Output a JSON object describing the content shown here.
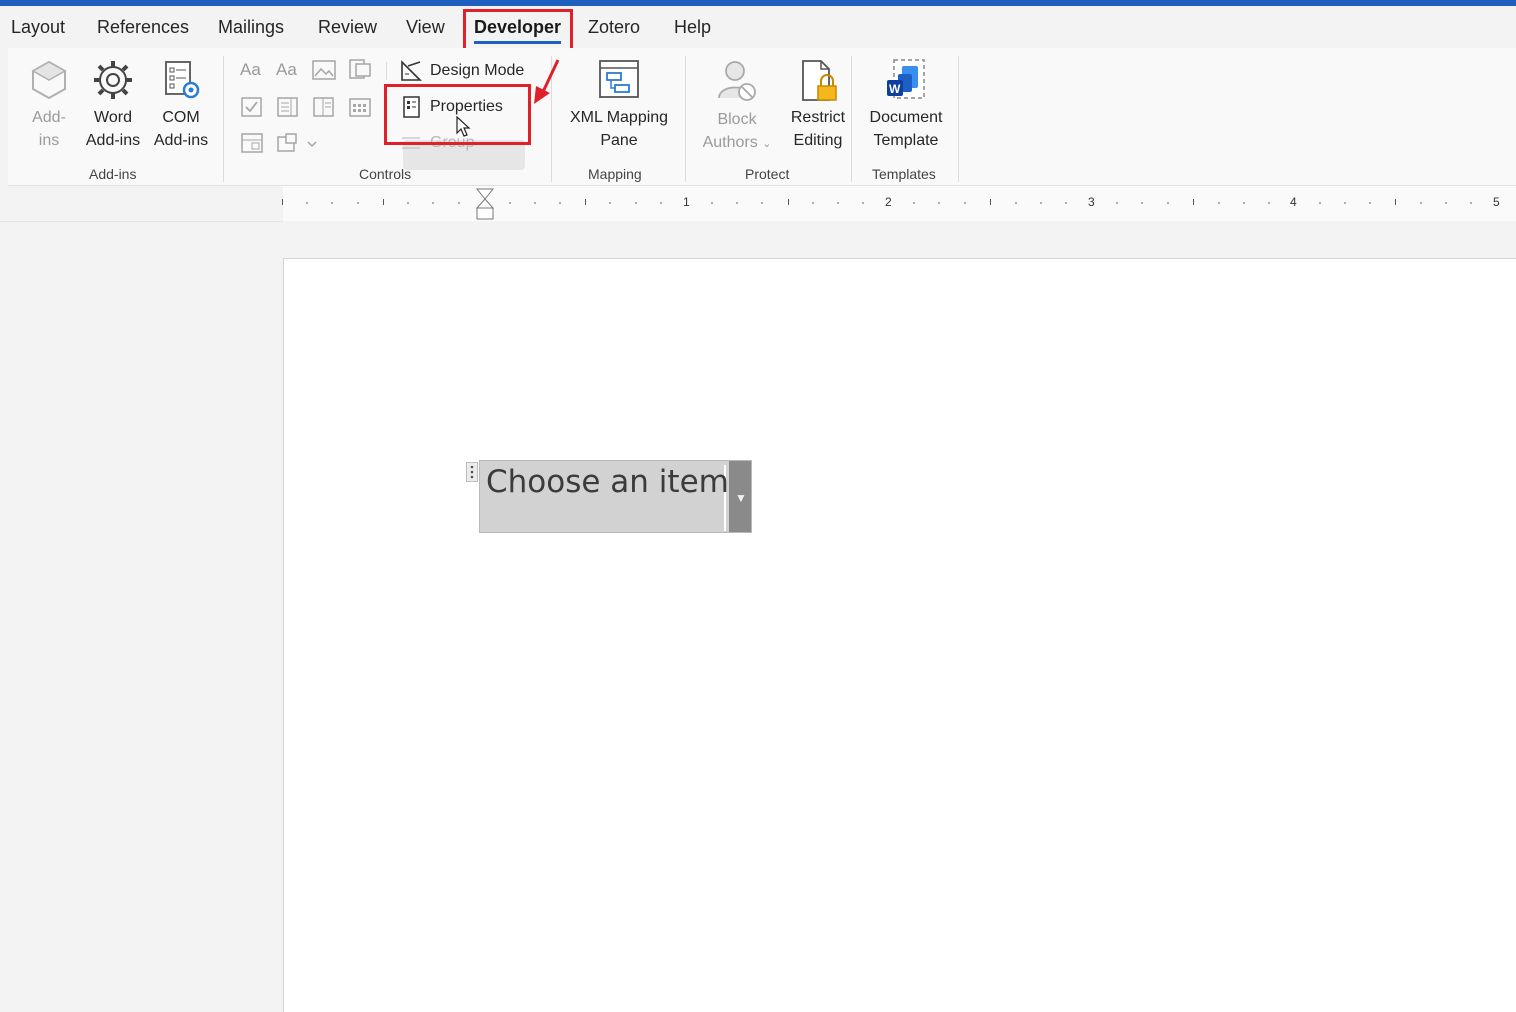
{
  "tabs": [
    "Layout",
    "References",
    "Mailings",
    "Review",
    "View",
    "Developer",
    "Zotero",
    "Help"
  ],
  "active_tab": "Developer",
  "ribbon": {
    "addins_group": {
      "label": "Add-ins",
      "addins_line1": "Add-",
      "addins_line2": "ins",
      "word_line1": "Word",
      "word_line2": "Add-ins",
      "com_line1": "COM",
      "com_line2": "Add-ins"
    },
    "controls_group": {
      "label": "Controls",
      "design_mode": "Design Mode",
      "properties": "Properties",
      "group": "Group"
    },
    "mapping_group": {
      "label": "Mapping",
      "xml_line1": "XML Mapping",
      "xml_line2": "Pane"
    },
    "protect_group": {
      "label": "Protect",
      "block_line1": "Block",
      "block_line2": "Authors",
      "restrict_line1": "Restrict",
      "restrict_line2": "Editing"
    },
    "templates_group": {
      "label": "Templates",
      "doc_line1": "Document",
      "doc_line2": "Template"
    }
  },
  "ruler": {
    "numbers": [
      "1",
      "2",
      "3",
      "4",
      "5"
    ]
  },
  "document": {
    "content_control_text": "Choose an item."
  },
  "colors": {
    "accent": "#1f5fbf",
    "highlight_red": "#e0202a"
  }
}
